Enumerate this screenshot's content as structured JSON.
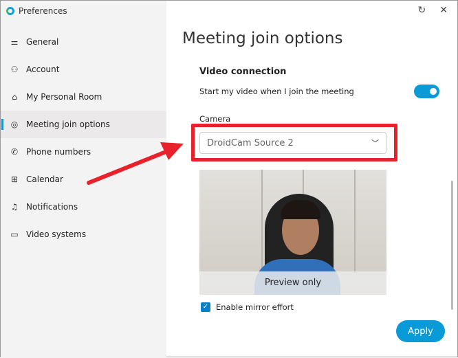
{
  "window": {
    "title": "Preferences",
    "refresh_icon": "↻",
    "close_icon": "✕"
  },
  "sidebar": {
    "items": [
      {
        "label": "General",
        "icon": "⚌"
      },
      {
        "label": "Account",
        "icon": "⚇"
      },
      {
        "label": "My Personal Room",
        "icon": "⌂"
      },
      {
        "label": "Meeting join options",
        "icon": "◎"
      },
      {
        "label": "Phone numbers",
        "icon": "✆"
      },
      {
        "label": "Calendar",
        "icon": "⊞"
      },
      {
        "label": "Notifications",
        "icon": "♫"
      },
      {
        "label": "Video systems",
        "icon": "▭"
      }
    ],
    "active": 3
  },
  "main": {
    "title": "Meeting join options",
    "section": "Video connection",
    "start_video_label": "Start my video when I join the meeting",
    "start_video_on": true,
    "camera_label": "Camera",
    "camera_value": "DroidCam Source 2",
    "preview_label": "Preview only",
    "mirror_label": "Enable mirror effort",
    "mirror_checked": true,
    "apply_label": "Apply"
  },
  "colors": {
    "accent": "#0a9ad8",
    "highlight": "#e8222b"
  }
}
